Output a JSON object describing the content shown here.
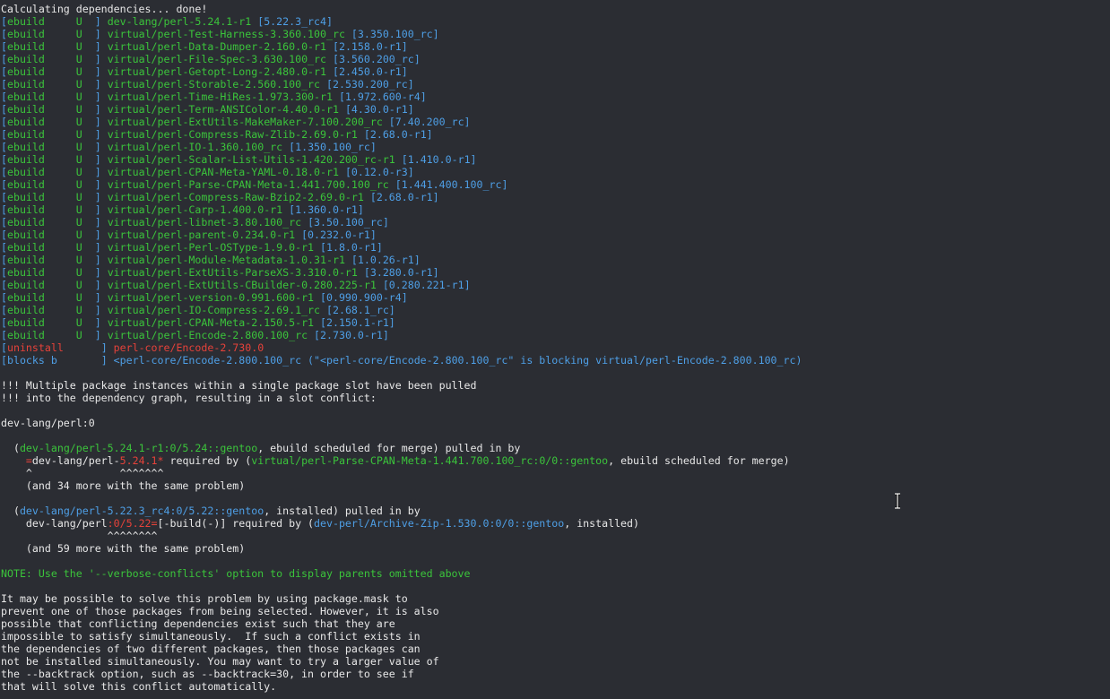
{
  "header": "Calculating dependencies... done!",
  "packages": [
    {
      "action": "ebuild",
      "flag": "U",
      "name": "dev-lang/perl-5.24.1-r1",
      "old": "[5.22.3_rc4]"
    },
    {
      "action": "ebuild",
      "flag": "U",
      "name": "virtual/perl-Test-Harness-3.360.100_rc",
      "old": "[3.350.100_rc]"
    },
    {
      "action": "ebuild",
      "flag": "U",
      "name": "virtual/perl-Data-Dumper-2.160.0-r1",
      "old": "[2.158.0-r1]"
    },
    {
      "action": "ebuild",
      "flag": "U",
      "name": "virtual/perl-File-Spec-3.630.100_rc",
      "old": "[3.560.200_rc]"
    },
    {
      "action": "ebuild",
      "flag": "U",
      "name": "virtual/perl-Getopt-Long-2.480.0-r1",
      "old": "[2.450.0-r1]"
    },
    {
      "action": "ebuild",
      "flag": "U",
      "name": "virtual/perl-Storable-2.560.100_rc",
      "old": "[2.530.200_rc]"
    },
    {
      "action": "ebuild",
      "flag": "U",
      "name": "virtual/perl-Time-HiRes-1.973.300-r1",
      "old": "[1.972.600-r4]"
    },
    {
      "action": "ebuild",
      "flag": "U",
      "name": "virtual/perl-Term-ANSIColor-4.40.0-r1",
      "old": "[4.30.0-r1]"
    },
    {
      "action": "ebuild",
      "flag": "U",
      "name": "virtual/perl-ExtUtils-MakeMaker-7.100.200_rc",
      "old": "[7.40.200_rc]"
    },
    {
      "action": "ebuild",
      "flag": "U",
      "name": "virtual/perl-Compress-Raw-Zlib-2.69.0-r1",
      "old": "[2.68.0-r1]"
    },
    {
      "action": "ebuild",
      "flag": "U",
      "name": "virtual/perl-IO-1.360.100_rc",
      "old": "[1.350.100_rc]"
    },
    {
      "action": "ebuild",
      "flag": "U",
      "name": "virtual/perl-Scalar-List-Utils-1.420.200_rc-r1",
      "old": "[1.410.0-r1]"
    },
    {
      "action": "ebuild",
      "flag": "U",
      "name": "virtual/perl-CPAN-Meta-YAML-0.18.0-r1",
      "old": "[0.12.0-r3]"
    },
    {
      "action": "ebuild",
      "flag": "U",
      "name": "virtual/perl-Parse-CPAN-Meta-1.441.700.100_rc",
      "old": "[1.441.400.100_rc]"
    },
    {
      "action": "ebuild",
      "flag": "U",
      "name": "virtual/perl-Compress-Raw-Bzip2-2.69.0-r1",
      "old": "[2.68.0-r1]"
    },
    {
      "action": "ebuild",
      "flag": "U",
      "name": "virtual/perl-Carp-1.400.0-r1",
      "old": "[1.360.0-r1]"
    },
    {
      "action": "ebuild",
      "flag": "U",
      "name": "virtual/perl-libnet-3.80.100_rc",
      "old": "[3.50.100_rc]"
    },
    {
      "action": "ebuild",
      "flag": "U",
      "name": "virtual/perl-parent-0.234.0-r1",
      "old": "[0.232.0-r1]"
    },
    {
      "action": "ebuild",
      "flag": "U",
      "name": "virtual/perl-Perl-OSType-1.9.0-r1",
      "old": "[1.8.0-r1]"
    },
    {
      "action": "ebuild",
      "flag": "U",
      "name": "virtual/perl-Module-Metadata-1.0.31-r1",
      "old": "[1.0.26-r1]"
    },
    {
      "action": "ebuild",
      "flag": "U",
      "name": "virtual/perl-ExtUtils-ParseXS-3.310.0-r1",
      "old": "[3.280.0-r1]"
    },
    {
      "action": "ebuild",
      "flag": "U",
      "name": "virtual/perl-ExtUtils-CBuilder-0.280.225-r1",
      "old": "[0.280.221-r1]"
    },
    {
      "action": "ebuild",
      "flag": "U",
      "name": "virtual/perl-version-0.991.600-r1",
      "old": "[0.990.900-r4]"
    },
    {
      "action": "ebuild",
      "flag": "U",
      "name": "virtual/perl-IO-Compress-2.69.1_rc",
      "old": "[2.68.1_rc]"
    },
    {
      "action": "ebuild",
      "flag": "U",
      "name": "virtual/perl-CPAN-Meta-2.150.5-r1",
      "old": "[2.150.1-r1]"
    },
    {
      "action": "ebuild",
      "flag": "U",
      "name": "virtual/perl-Encode-2.800.100_rc",
      "old": "[2.730.0-r1]"
    }
  ],
  "uninstall": {
    "action": "uninstall",
    "name": "perl-core/Encode-2.730.0"
  },
  "blocks": {
    "action": "blocks b",
    "text": "<perl-core/Encode-2.800.100_rc (\"<perl-core/Encode-2.800.100_rc\" is blocking virtual/perl-Encode-2.800.100_rc)"
  },
  "conflict_msg": [
    "!!! Multiple package instances within a single package slot have been pulled",
    "!!! into the dependency graph, resulting in a slot conflict:"
  ],
  "slot": "dev-lang/perl:0",
  "conflict1": {
    "open": "  (",
    "pkg": "dev-lang/perl-5.24.1-r1:0/5.24::gentoo",
    "rest": ", ebuild scheduled for merge) pulled in by",
    "req_prefix": "    ",
    "req_eq": "=",
    "req_name": "dev-lang/perl-",
    "req_ver": "5.24.1*",
    "req_mid": " required by (",
    "req_pkg": "virtual/perl-Parse-CPAN-Meta-1.441.700.100_rc:0/0::gentoo",
    "req_end": ", ebuild scheduled for merge)",
    "caret": "    ^              ^^^^^^^",
    "more": "    (and 34 more with the same problem)"
  },
  "conflict2": {
    "open": "  (",
    "pkg": "dev-lang/perl-5.22.3_rc4:0/5.22::gentoo",
    "rest": ", installed) pulled in by",
    "req_prefix": "    dev-lang/perl",
    "req_slot": ":0/5.22=",
    "req_mid": "[-build(-)] required by (",
    "req_pkg": "dev-perl/Archive-Zip-1.530.0:0/0::gentoo",
    "req_end": ", installed)",
    "caret": "                 ^^^^^^^^",
    "more": "    (and 59 more with the same problem)"
  },
  "note": "NOTE: Use the '--verbose-conflicts' option to display parents omitted above",
  "advice": [
    "It may be possible to solve this problem by using package.mask to",
    "prevent one of those packages from being selected. However, it is also",
    "possible that conflicting dependencies exist such that they are",
    "impossible to satisfy simultaneously.  If such a conflict exists in",
    "the dependencies of two different packages, then those packages can",
    "not be installed simultaneously. You may want to try a larger value of",
    "the --backtrack option, such as --backtrack=30, in order to see if",
    "that will solve this conflict automatically."
  ],
  "colors": {
    "background": "#2b2d33",
    "green": "#3bc43b",
    "blue": "#4e9fe6",
    "red": "#e6423a",
    "text": "#e8e8e8"
  },
  "icons": {
    "cursor": "ibeam-cursor-icon"
  }
}
